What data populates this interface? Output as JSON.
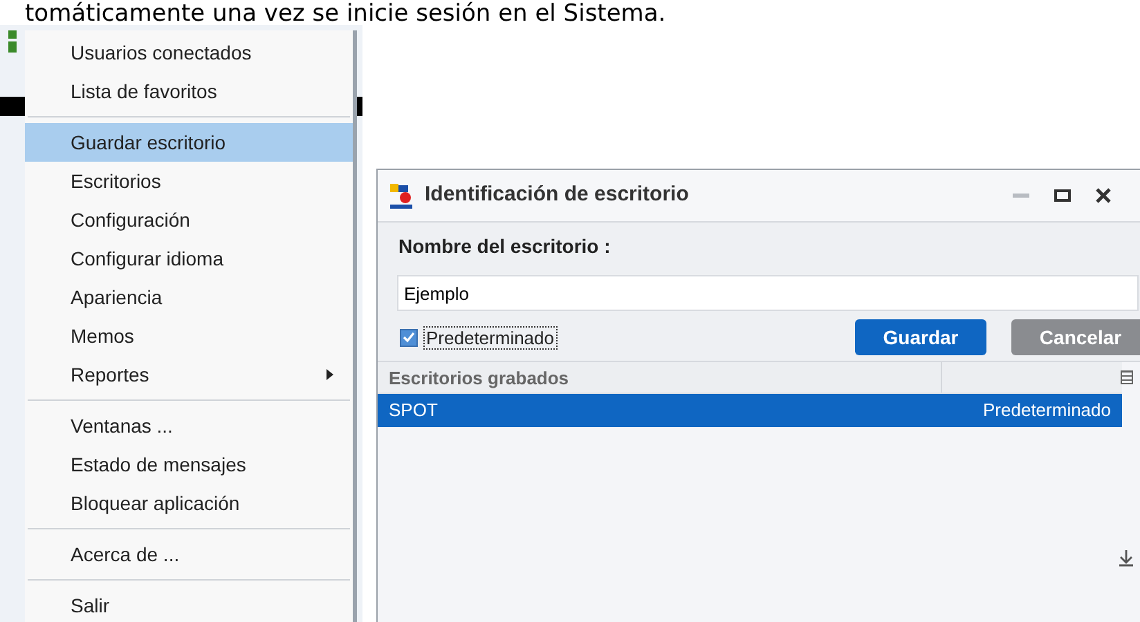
{
  "caption": "tomáticamente una vez se inicie sesión en el Sistema.",
  "menu": {
    "groups": [
      [
        {
          "label": "Usuarios conectados",
          "selected": false
        },
        {
          "label": "Lista de favoritos",
          "selected": false
        }
      ],
      [
        {
          "label": "Guardar escritorio",
          "selected": true
        },
        {
          "label": "Escritorios",
          "selected": false
        },
        {
          "label": "Configuración",
          "selected": false
        },
        {
          "label": "Configurar idioma",
          "selected": false
        },
        {
          "label": "Apariencia",
          "selected": false
        },
        {
          "label": "Memos",
          "selected": false
        },
        {
          "label": "Reportes",
          "selected": false,
          "submenu": true
        }
      ],
      [
        {
          "label": "Ventanas ...",
          "selected": false
        },
        {
          "label": "Estado de mensajes",
          "selected": false
        },
        {
          "label": "Bloquear aplicación",
          "selected": false
        }
      ],
      [
        {
          "label": "Acerca de ...",
          "selected": false
        }
      ],
      [
        {
          "label": "Salir",
          "selected": false
        }
      ]
    ]
  },
  "dialog": {
    "title": "Identificación de escritorio",
    "name_label": "Nombre del escritorio :",
    "name_field": {
      "value": "Ejemplo"
    },
    "default_checkbox": {
      "label": "Predeterminado",
      "checked": true
    },
    "buttons": [
      {
        "label": "Guardar",
        "kind": "primary"
      },
      {
        "label": "Cancelar",
        "kind": "secondary"
      }
    ],
    "table": {
      "columns": [
        "Escritorios grabados"
      ],
      "rows": [
        {
          "cells": [
            "SPOT",
            "Predeterminado"
          ],
          "selected": true
        }
      ]
    }
  }
}
